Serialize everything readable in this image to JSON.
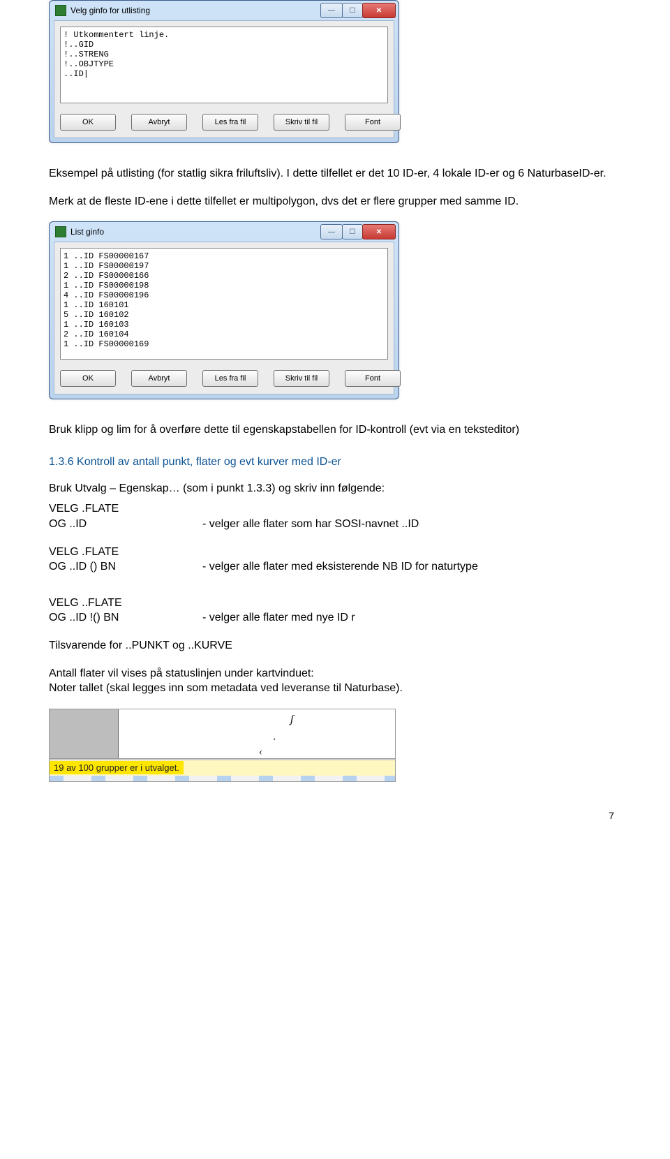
{
  "dialog1": {
    "title": "Velg ginfo for utlisting",
    "text": "! Utkommentert linje.\n!..GID\n!..STRENG\n!..OBJTYPE\n..ID|",
    "buttons": {
      "ok": "OK",
      "avbryt": "Avbryt",
      "les": "Les fra fil",
      "skriv": "Skriv til fil",
      "font": "Font"
    }
  },
  "para1": "Eksempel på utlisting (for statlig sikra friluftsliv). I dette tilfellet er det 10 ID-er, 4 lokale ID-er og 6 NaturbaseID-er.",
  "para2": "Merk at de fleste ID-ene i dette tilfellet er multipolygon, dvs det er flere grupper med samme ID.",
  "dialog2": {
    "title": "List ginfo",
    "text": "1 ..ID FS00000167\n1 ..ID FS00000197\n2 ..ID FS00000166\n1 ..ID FS00000198\n4 ..ID FS00000196\n1 ..ID 160101\n5 ..ID 160102\n1 ..ID 160103\n2 ..ID 160104\n1 ..ID FS00000169",
    "buttons": {
      "ok": "OK",
      "avbryt": "Avbryt",
      "les": "Les fra fil",
      "skriv": "Skriv til fil",
      "font": "Font"
    }
  },
  "para3": "Bruk klipp og lim for å overføre dette til egenskapstabellen for ID-kontroll (evt via en teksteditor)",
  "heading": "1.3.6 Kontroll av antall punkt, flater og evt kurver med ID-er",
  "para4": "Bruk Utvalg – Egenskap… (som i punkt 1.3.3) og skriv inn følgende:",
  "cmds": {
    "c1a": "VELG .FLATE",
    "c1b_left": "OG ..ID",
    "c1b_right": "- velger alle flater som har SOSI-navnet ..ID",
    "c2a": "VELG .FLATE",
    "c2b_left": "OG ..ID () BN",
    "c2b_right": "- velger alle flater med eksisterende NB ID for naturtype",
    "c3a": "VELG ..FLATE",
    "c3b_left": "OG ..ID !() BN",
    "c3b_right": "- velger alle flater med nye ID r"
  },
  "para5": "Tilsvarende for ..PUNKT og ..KURVE",
  "para6": "Antall flater vil vises på statuslinjen under kartvinduet:",
  "para7": "Noter tallet (skal legges inn som metadata ved leveranse til Naturbase).",
  "statusbar": "19 av 100 grupper er i utvalget.",
  "page_number": "7"
}
